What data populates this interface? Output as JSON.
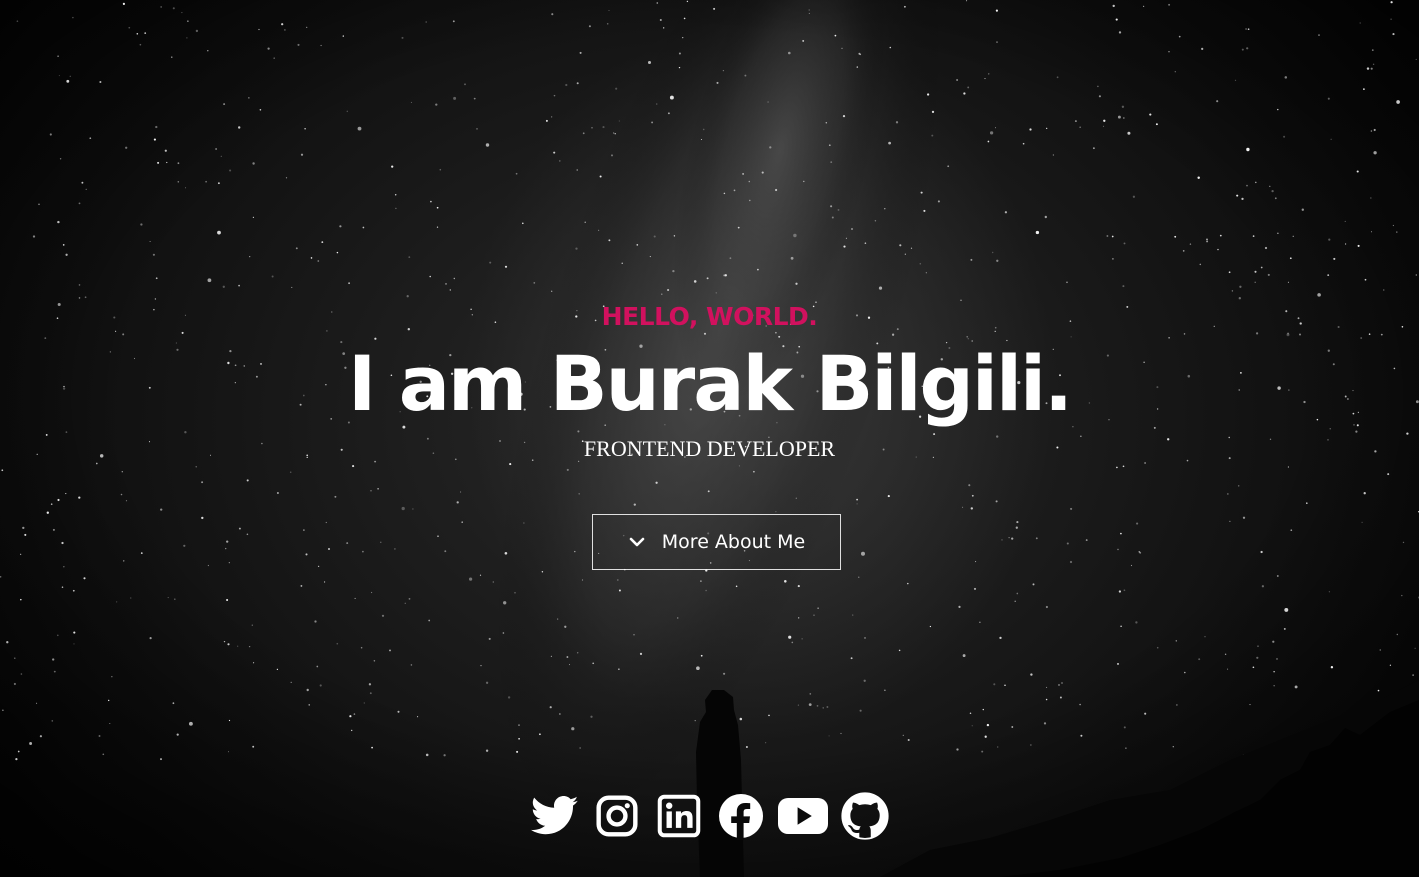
{
  "hero": {
    "greeting": "HELLO, WORLD.",
    "name": "I am Burak Bilgili.",
    "role": "FRONTEND DEVELOPER",
    "cta_label": "More About Me",
    "cta_icon": "chevron-down-icon"
  },
  "socials": [
    {
      "name": "twitter",
      "icon": "twitter-icon"
    },
    {
      "name": "instagram",
      "icon": "instagram-icon"
    },
    {
      "name": "linkedin",
      "icon": "linkedin-icon"
    },
    {
      "name": "facebook",
      "icon": "facebook-icon"
    },
    {
      "name": "youtube",
      "icon": "youtube-icon"
    },
    {
      "name": "github",
      "icon": "github-icon"
    }
  ],
  "colors": {
    "accent": "#d1115e",
    "text": "#ffffff",
    "background": "#0a0a0a"
  }
}
